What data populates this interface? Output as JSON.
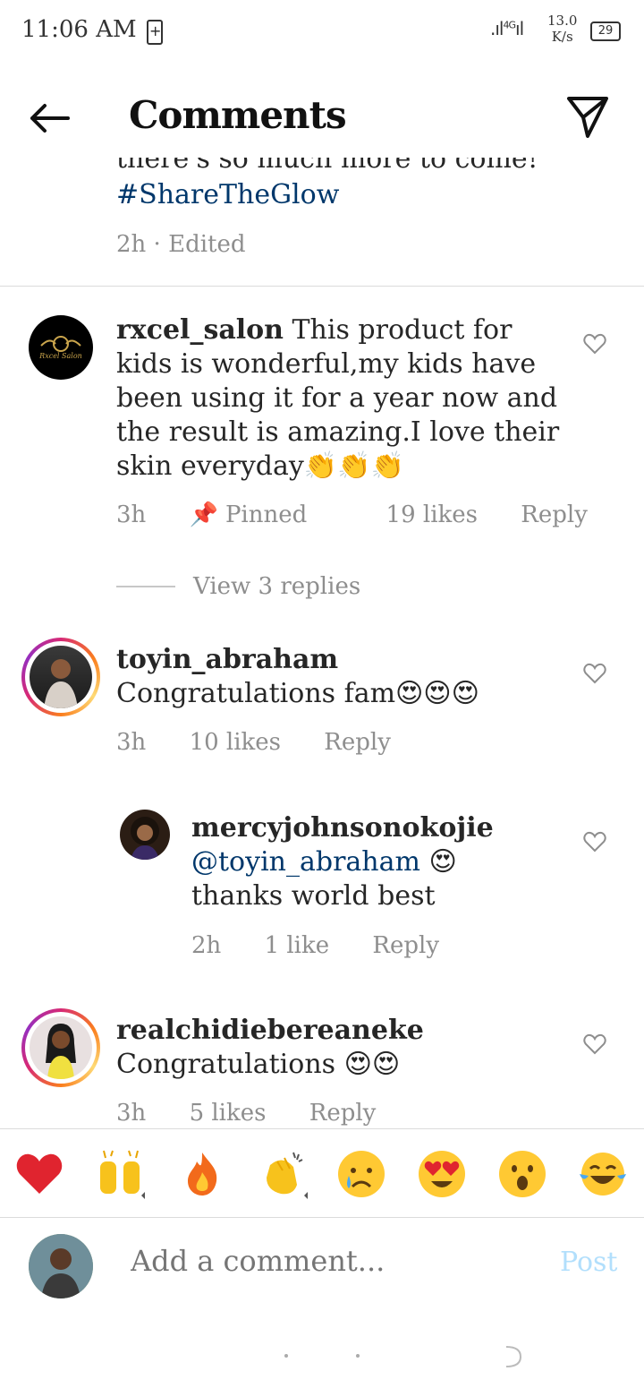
{
  "status": {
    "time": "11:06 AM",
    "network_type": "4G",
    "speed_value": "13.0",
    "speed_unit": "K/s",
    "battery": "29"
  },
  "header": {
    "title": "Comments"
  },
  "previous_comment": {
    "cut_text": "there's so much more to come!",
    "hashtag": "#ShareTheGlow",
    "time": "2h",
    "edited": "Edited"
  },
  "comments": [
    {
      "username": "rxcel_salon",
      "text": "This product for kids is wonderful,my kids have been using it for a year now and the result is amazing.I love their skin everyday",
      "emoji": "👏👏👏",
      "time": "3h",
      "pinned": "Pinned",
      "likes": "19 likes",
      "reply": "Reply",
      "avatar_text": "Rxcel Salon"
    },
    {
      "username": "toyin_abraham",
      "text": "Congratulations fam",
      "emoji": "😍😍😍",
      "time": "3h",
      "likes": "10 likes",
      "reply": "Reply"
    },
    {
      "username": "mercyjohnsonokojie",
      "mention": "@toyin_abraham",
      "emoji": "😍",
      "text": "thanks world best",
      "time": "2h",
      "likes": "1 like",
      "reply": "Reply"
    },
    {
      "username": "realchidiebereaneke",
      "text": "Congratulations",
      "emoji": "😍😍",
      "time": "3h",
      "likes": "5 likes",
      "reply": "Reply"
    }
  ],
  "view_replies": "View 3 replies",
  "reactions": [
    "❤️",
    "🙌",
    "🔥",
    "👏",
    "😢",
    "😍",
    "😮",
    "😂"
  ],
  "input": {
    "placeholder": "Add a comment...",
    "post_label": "Post"
  },
  "colors": {
    "link": "#00376b",
    "muted": "#8e8e8e",
    "post_disabled": "#b2dffc",
    "divider": "#dbdbdb"
  }
}
